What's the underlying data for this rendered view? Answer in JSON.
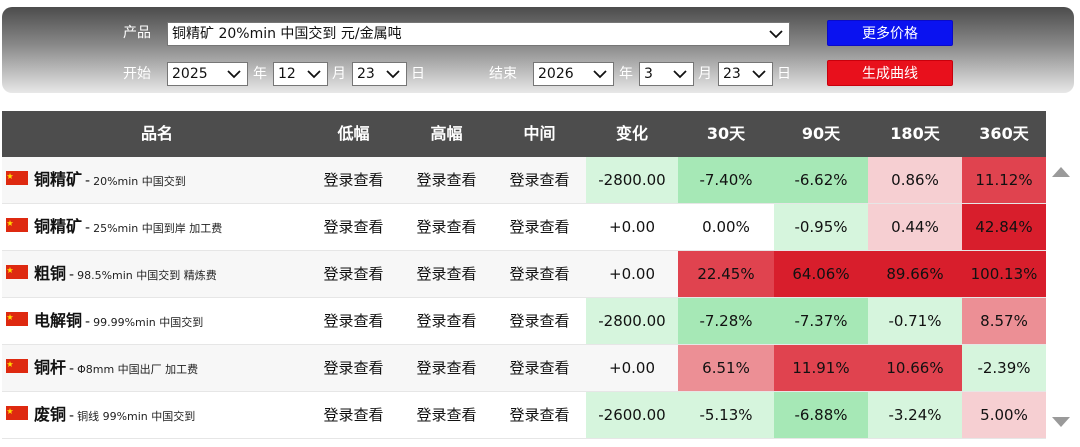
{
  "controls": {
    "product_label": "产品",
    "product_value": "铜精矿 20%min 中国交到 元/金属吨",
    "start_label": "开始",
    "end_label": "结束",
    "start": {
      "year": "2025",
      "month": "12",
      "day": "23"
    },
    "end": {
      "year": "2026",
      "month": "3",
      "day": "23"
    },
    "year_unit": "年",
    "month_unit": "月",
    "day_unit": "日",
    "more_prices_button": "更多价格",
    "generate_curve_button": "生成曲线"
  },
  "table": {
    "headers": [
      "品名",
      "低幅",
      "高幅",
      "中间",
      "变化",
      "30天",
      "90天",
      "180天",
      "360天"
    ],
    "rows": [
      {
        "name": "铜精矿",
        "spec": "20%min 中国交到",
        "low": "登录查看",
        "high": "登录查看",
        "mid": "登录查看",
        "change": "-2800.00",
        "d30": "-7.40%",
        "d90": "-6.62%",
        "d180": "0.86%",
        "d360": "11.12%"
      },
      {
        "name": "铜精矿",
        "spec": "25%min 中国到岸 加工费",
        "low": "登录查看",
        "high": "登录查看",
        "mid": "登录查看",
        "change": "+0.00",
        "d30": "0.00%",
        "d90": "-0.95%",
        "d180": "0.44%",
        "d360": "42.84%"
      },
      {
        "name": "粗铜",
        "spec": "98.5%min 中国交到 精炼费",
        "low": "登录查看",
        "high": "登录查看",
        "mid": "登录查看",
        "change": "+0.00",
        "d30": "22.45%",
        "d90": "64.06%",
        "d180": "89.66%",
        "d360": "100.13%"
      },
      {
        "name": "电解铜",
        "spec": "99.99%min 中国交到",
        "low": "登录查看",
        "high": "登录查看",
        "mid": "登录查看",
        "change": "-2800.00",
        "d30": "-7.28%",
        "d90": "-7.37%",
        "d180": "-0.71%",
        "d360": "8.57%"
      },
      {
        "name": "铜杆",
        "spec": "Φ8mm 中国出厂 加工费",
        "low": "登录查看",
        "high": "登录查看",
        "mid": "登录查看",
        "change": "+0.00",
        "d30": "6.51%",
        "d90": "11.91%",
        "d180": "10.66%",
        "d360": "-2.39%"
      },
      {
        "name": "废铜",
        "spec": "铜线 99%min 中国交到",
        "low": "登录查看",
        "high": "登录查看",
        "mid": "登录查看",
        "change": "-2600.00",
        "d30": "-5.13%",
        "d90": "-6.88%",
        "d180": "-3.24%",
        "d360": "5.00%"
      }
    ]
  },
  "colors": {
    "header_bg": "#4d4d4d",
    "green_light": "#d6f5dd",
    "green_mid": "#a6e8b6",
    "red_light": "#f6cfd2",
    "red_mid": "#ec8f95",
    "red_strong": "#e0434f",
    "red_deep": "#d81e2c"
  },
  "icons": {
    "flag": "china-flag-icon",
    "scroll_up": "scroll-up-arrow-icon",
    "scroll_down": "scroll-down-arrow-icon"
  }
}
